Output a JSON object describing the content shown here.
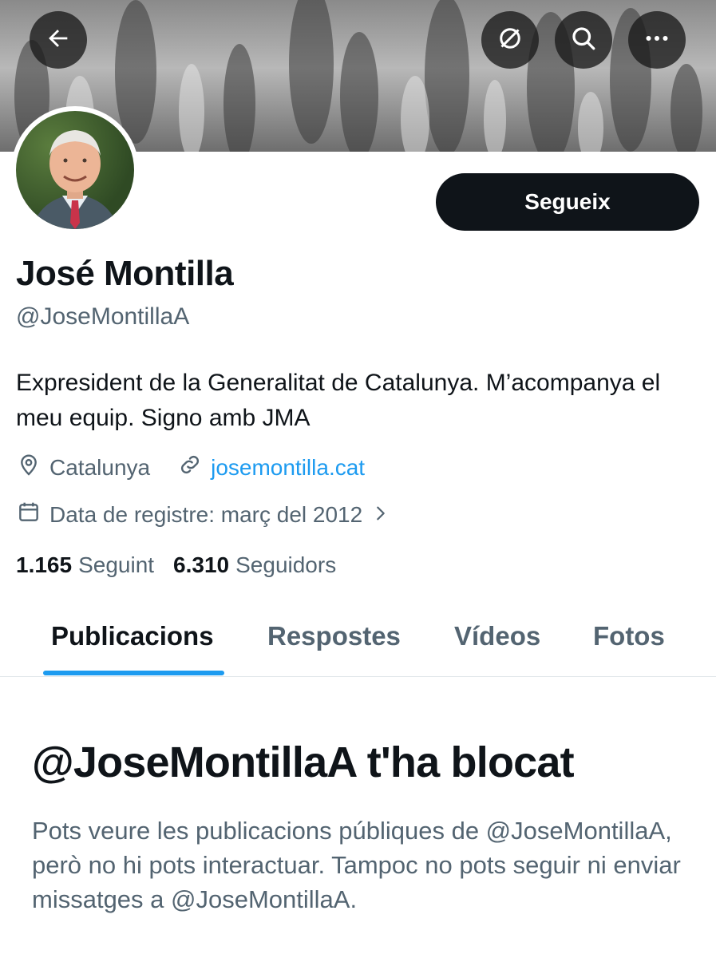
{
  "header": {
    "back_icon": "arrow-left-icon",
    "unfollow_icon": "circle-slash-icon",
    "search_icon": "search-icon",
    "more_icon": "more-dots-icon"
  },
  "profile": {
    "name": "José Montilla",
    "handle": "@JoseMontillaA",
    "follow_label": "Segueix",
    "bio": "Expresident de la Generalitat de Catalunya. M’acompanya el meu equip. Signo amb JMA",
    "location": "Catalunya",
    "website": "josemontilla.cat",
    "joined": "Data de registre: març del 2012",
    "following_count": "1.165",
    "following_label": "Seguint",
    "followers_count": "6.310",
    "followers_label": "Seguidors"
  },
  "tabs": [
    {
      "label": "Publicacions",
      "active": true
    },
    {
      "label": "Respostes",
      "active": false
    },
    {
      "label": "Vídeos",
      "active": false
    },
    {
      "label": "Fotos",
      "active": false
    }
  ],
  "blocked": {
    "title": "@JoseMontillaA t'ha blocat",
    "description": "Pots veure les publicacions públiques de @JoseMontillaA, però no hi pots interactuar. Tampoc no pots seguir ni enviar missatges a @JoseMontillaA."
  },
  "colors": {
    "accent": "#1d9bf0",
    "text_primary": "#0f1419",
    "text_secondary": "#536471",
    "button_bg": "#0f1419"
  }
}
